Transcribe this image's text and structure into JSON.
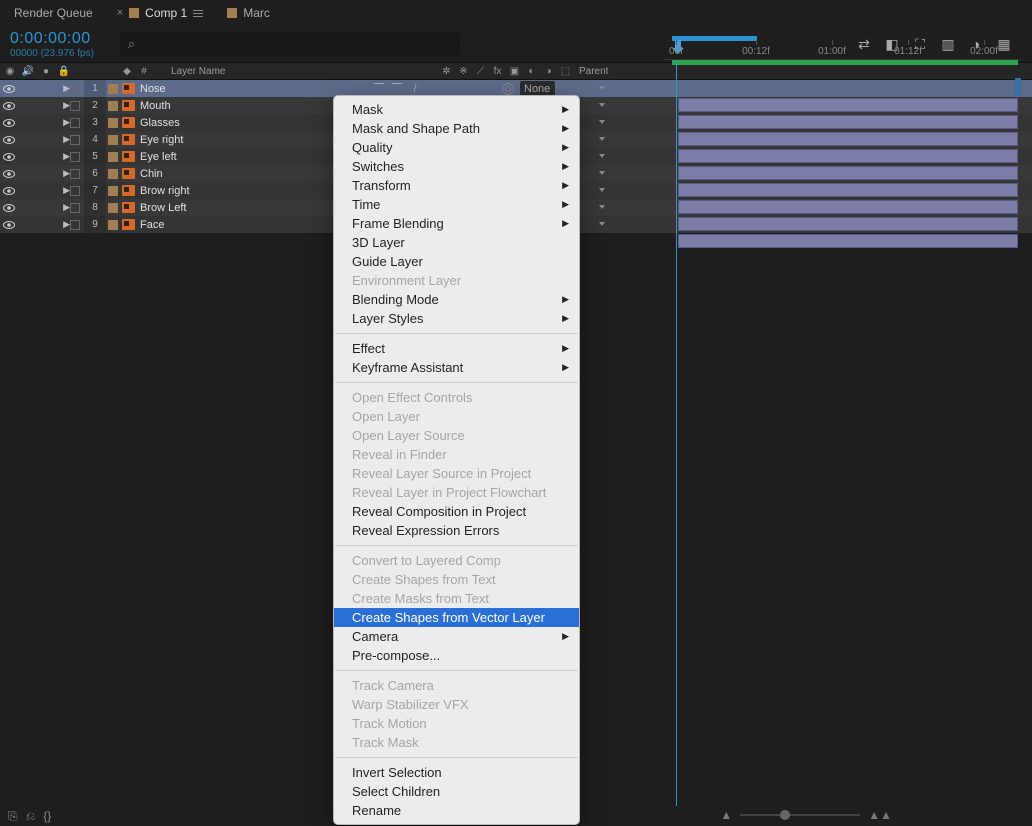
{
  "tabs": [
    {
      "label": "Render Queue",
      "icon": "none",
      "active": false
    },
    {
      "label": "Comp 1",
      "icon": "comp",
      "active": true
    },
    {
      "label": "Marc",
      "icon": "comp",
      "active": false
    }
  ],
  "timecode": {
    "value": "0:00:00:00",
    "fps": "00000 (23.976 fps)"
  },
  "columns": {
    "layerName": "Layer Name",
    "numSym": "#",
    "parent": "Parent"
  },
  "ruler": [
    "00f",
    "00:12f",
    "01:00f",
    "01:12f",
    "02:00f"
  ],
  "parentDefault": "None",
  "layers": [
    {
      "num": 1,
      "name": "Nose",
      "selected": true
    },
    {
      "num": 2,
      "name": "Mouth",
      "selected": false
    },
    {
      "num": 3,
      "name": "Glasses",
      "selected": false
    },
    {
      "num": 4,
      "name": "Eye right",
      "selected": false
    },
    {
      "num": 5,
      "name": "Eye left",
      "selected": false
    },
    {
      "num": 6,
      "name": "Chin",
      "selected": false
    },
    {
      "num": 7,
      "name": "Brow right",
      "selected": false
    },
    {
      "num": 8,
      "name": "Brow Left",
      "selected": false
    },
    {
      "num": 9,
      "name": "Face",
      "selected": false
    }
  ],
  "menu": [
    {
      "label": "Mask",
      "sub": true
    },
    {
      "label": "Mask and Shape Path",
      "sub": true
    },
    {
      "label": "Quality",
      "sub": true
    },
    {
      "label": "Switches",
      "sub": true
    },
    {
      "label": "Transform",
      "sub": true
    },
    {
      "label": "Time",
      "sub": true
    },
    {
      "label": "Frame Blending",
      "sub": true
    },
    {
      "label": "3D Layer"
    },
    {
      "label": "Guide Layer"
    },
    {
      "label": "Environment Layer",
      "disabled": true
    },
    {
      "label": "Blending Mode",
      "sub": true
    },
    {
      "label": "Layer Styles",
      "sub": true
    },
    {
      "sep": true
    },
    {
      "label": "Effect",
      "sub": true
    },
    {
      "label": "Keyframe Assistant",
      "sub": true
    },
    {
      "sep": true
    },
    {
      "label": "Open Effect Controls",
      "disabled": true
    },
    {
      "label": "Open Layer",
      "disabled": true
    },
    {
      "label": "Open Layer Source",
      "disabled": true
    },
    {
      "label": "Reveal in Finder",
      "disabled": true
    },
    {
      "label": "Reveal Layer Source in Project",
      "disabled": true
    },
    {
      "label": "Reveal Layer in Project Flowchart",
      "disabled": true
    },
    {
      "label": "Reveal Composition in Project"
    },
    {
      "label": "Reveal Expression Errors"
    },
    {
      "sep": true
    },
    {
      "label": "Convert to Layered Comp",
      "disabled": true
    },
    {
      "label": "Create Shapes from Text",
      "disabled": true
    },
    {
      "label": "Create Masks from Text",
      "disabled": true
    },
    {
      "label": "Create Shapes from Vector Layer",
      "highlight": true
    },
    {
      "label": "Camera",
      "sub": true
    },
    {
      "label": "Pre-compose..."
    },
    {
      "sep": true
    },
    {
      "label": "Track Camera",
      "disabled": true
    },
    {
      "label": "Warp Stabilizer VFX",
      "disabled": true
    },
    {
      "label": "Track Motion",
      "disabled": true
    },
    {
      "label": "Track Mask",
      "disabled": true
    },
    {
      "sep": true
    },
    {
      "label": "Invert Selection"
    },
    {
      "label": "Select Children"
    },
    {
      "label": "Rename"
    }
  ]
}
